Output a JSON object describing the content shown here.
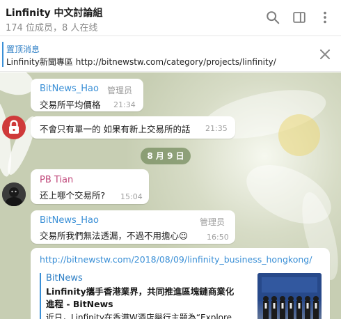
{
  "header": {
    "title": "Linfinity 中文討論組",
    "subtitle": "174 位成员，8 人在线",
    "icons": [
      "search-icon",
      "sidebar-toggle-icon",
      "more-vertical-icon"
    ]
  },
  "pinned": {
    "title": "置顶消息",
    "text": "Linfinity新聞專區 http://bitnewstw.com/category/projects/linfinity/",
    "close_icon": "close-icon"
  },
  "messages": [
    {
      "name": "BitNews_Hao",
      "role": "管理员",
      "text": "交易所平均價格",
      "time": "21:34"
    },
    {
      "text": "不會只有單一的  如果有新上交易所的話",
      "time": "21:35"
    },
    {
      "name": "PB Tian",
      "text": "还上哪个交易所?",
      "time": "15:04"
    },
    {
      "name": "BitNews_Hao",
      "role": "管理员",
      "text": "交易所我們無法透漏，不過不用擔心☺",
      "time": "16:50"
    }
  ],
  "date_pill": "8 月 9 日",
  "link_message": {
    "url": "http://bitnewstw.com/2018/08/09/linfinity_business_hongkong/",
    "site": "BitNews",
    "title": "Linfinity攜手香港業界，共同推進區塊鏈商業化進程 - BitNews",
    "description": "近日，Linfinity在香港W酒店舉行主題為“Explore"
  },
  "colors": {
    "accent": "#3a8fd6",
    "name_admin": "#3a8fd6",
    "name_member": "#c0477a",
    "date_pill": "#768c5f"
  }
}
